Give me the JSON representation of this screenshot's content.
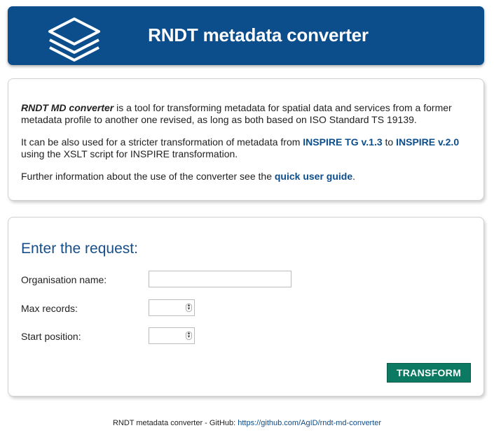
{
  "header": {
    "title": "RNDT metadata converter",
    "logo_icon": "layers-stack-icon"
  },
  "intro": {
    "p1_name": "RNDT MD converter",
    "p1_text": " is a tool for transforming metadata for spatial data and services from a former metadata profile to another one revised, as long as both based on ISO Standard TS 19139.",
    "p2_pre": "It can be also used for a stricter transformation of metadata from ",
    "p2_link1": "INSPIRE TG v.1.3",
    "p2_mid": " to ",
    "p2_link2": "INSPIRE v.2.0",
    "p2_post": " using the XSLT script for INSPIRE transformation.",
    "p3_pre": "Further information about the use of the converter see the ",
    "p3_link": "quick user guide",
    "p3_post": "."
  },
  "form": {
    "heading": "Enter the request:",
    "org_label": "Organisation name:",
    "org_value": "",
    "max_label": "Max records:",
    "max_value": "",
    "start_label": "Start position:",
    "start_value": "",
    "submit_label": "TRANSFORM"
  },
  "footer": {
    "text": "RNDT metadata converter - GitHub: ",
    "link": "https://github.com/AgID/rndt-md-converter"
  },
  "colors": {
    "header_bg": "#0c4d8c",
    "link": "#0c4d8c",
    "heading": "#174e8a",
    "button_bg": "#0c7a62"
  }
}
